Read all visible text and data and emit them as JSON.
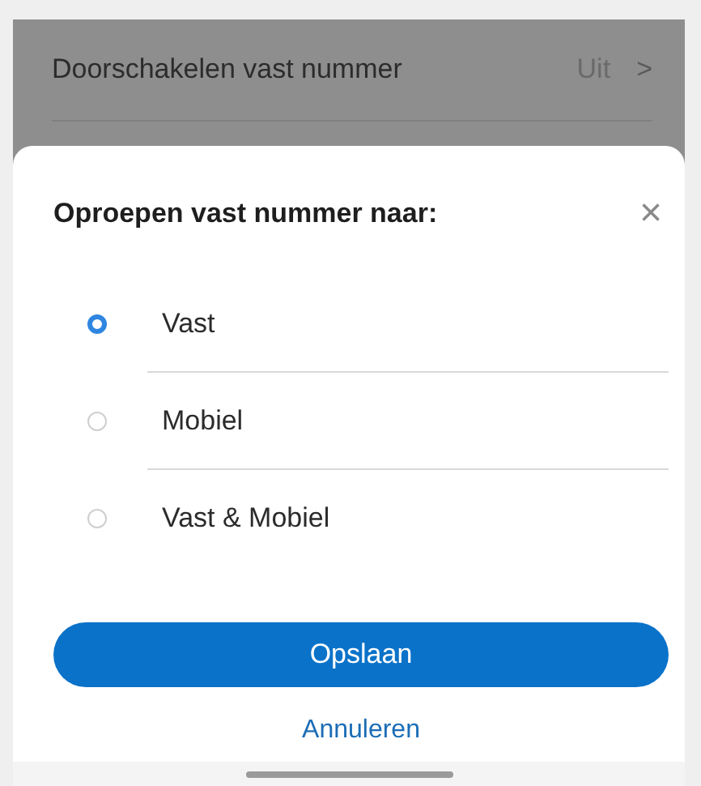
{
  "background_row": {
    "label": "Doorschakelen vast nummer",
    "value": "Uit",
    "chevron": ">"
  },
  "sheet": {
    "title": "Oproepen vast nummer naar:",
    "close": "×",
    "options": [
      {
        "label": "Vast",
        "selected": true
      },
      {
        "label": "Mobiel",
        "selected": false
      },
      {
        "label": "Vast & Mobiel",
        "selected": false
      }
    ],
    "primary_button": "Opslaan",
    "secondary_button": "Annuleren"
  }
}
